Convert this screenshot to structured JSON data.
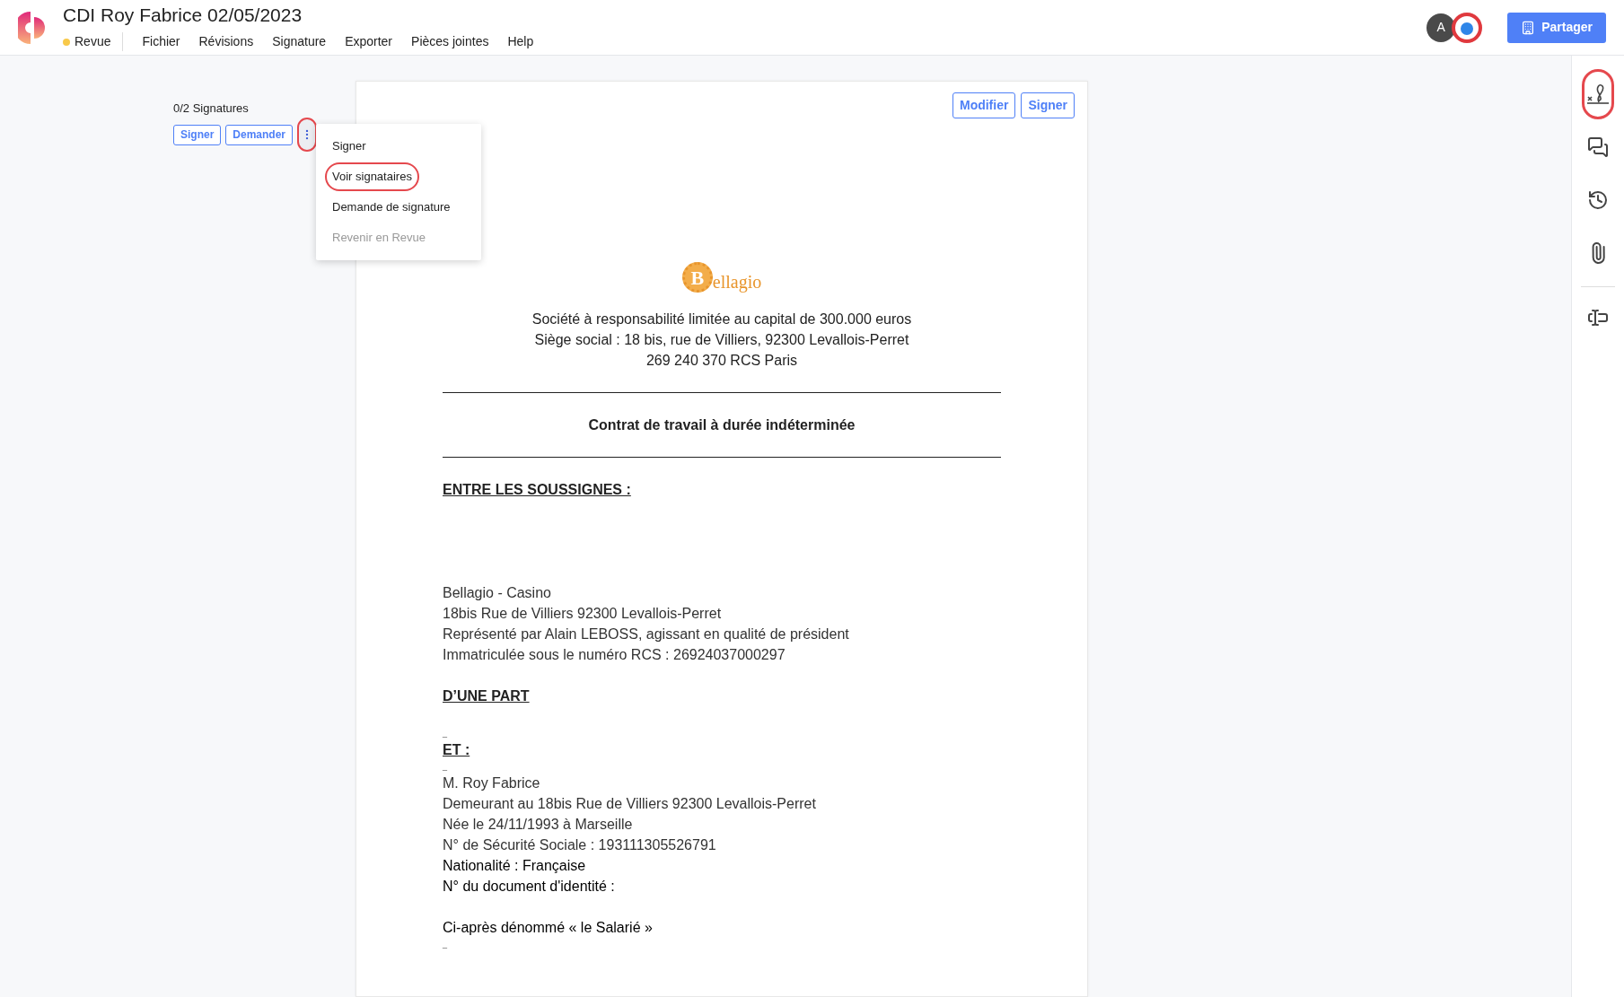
{
  "header": {
    "title": "CDI Roy Fabrice 02/05/2023",
    "status": {
      "label": "Revue",
      "color": "#f8c94a"
    },
    "menu": [
      "Fichier",
      "Révisions",
      "Signature",
      "Exporter",
      "Pièces jointes",
      "Help"
    ],
    "avatars": [
      {
        "kind": "letter",
        "text": "A"
      },
      {
        "kind": "logo"
      }
    ],
    "share_button": "Partager"
  },
  "signature_panel": {
    "count": "0/2 Signatures",
    "buttons": [
      "Signer",
      "Demander"
    ],
    "more_button": {
      "highlighted": true
    },
    "dropdown": [
      {
        "label": "Signer",
        "disabled": false,
        "highlighted": false
      },
      {
        "label": "Voir signataires",
        "disabled": false,
        "highlighted": true
      },
      {
        "label": "Demande de signature",
        "disabled": false,
        "highlighted": false
      },
      {
        "label": "Revenir en Revue",
        "disabled": true,
        "highlighted": false
      }
    ]
  },
  "document": {
    "buttons": [
      "Modifier",
      "Signer"
    ],
    "logo": {
      "initial": "B",
      "rest": "ellagio"
    },
    "blocks": [
      {
        "kind": "center",
        "text": "Société à responsabilité limitée au capital de 300.000 euros"
      },
      {
        "kind": "center",
        "text": "Siège social : 18 bis, rue de Villiers, 92300 Levallois-Perret"
      },
      {
        "kind": "center",
        "text": "269 240 370 RCS Paris"
      },
      {
        "kind": "rule"
      },
      {
        "kind": "title",
        "text": "Contrat de travail à durée indéterminée"
      },
      {
        "kind": "rule"
      },
      {
        "kind": "heading",
        "text": "ENTRE LES SOUSSIGNES :"
      },
      {
        "kind": "blank"
      },
      {
        "kind": "blank"
      },
      {
        "kind": "blank"
      },
      {
        "kind": "blank"
      },
      {
        "kind": "line",
        "text": "Bellagio - Casino"
      },
      {
        "kind": "line",
        "text": "18bis Rue de Villiers 92300 Levallois-Perret"
      },
      {
        "kind": "line",
        "text": "Représenté par Alain LEBOSS, agissant en qualité de président"
      },
      {
        "kind": "line",
        "text": "Immatriculée sous le numéro RCS : 26924037000297"
      },
      {
        "kind": "blank"
      },
      {
        "kind": "heading",
        "text": "D’UNE PART"
      },
      {
        "kind": "blank"
      },
      {
        "kind": "mark",
        "text": "_"
      },
      {
        "kind": "heading",
        "text": "ET :"
      },
      {
        "kind": "mark",
        "text": "_"
      },
      {
        "kind": "line",
        "text": "M. Roy Fabrice"
      },
      {
        "kind": "line",
        "text": "Demeurant au 18bis Rue de Villiers 92300 Levallois-Perret"
      },
      {
        "kind": "line",
        "text": "Née le 24/11/1993 à Marseille"
      },
      {
        "kind": "line",
        "text": "N° de Sécurité Sociale : 193111305526791"
      },
      {
        "kind": "dark",
        "text": "Nationalité : Française"
      },
      {
        "kind": "dark",
        "text": "N° du document d'identité :"
      },
      {
        "kind": "blank"
      },
      {
        "kind": "dark",
        "text": "Ci-après dénommé « le Salarié »"
      },
      {
        "kind": "mark",
        "text": "_"
      }
    ]
  },
  "rail": [
    {
      "kind": "signature",
      "highlighted": true
    },
    {
      "kind": "comments",
      "highlighted": false
    },
    {
      "kind": "history",
      "highlighted": false
    },
    {
      "kind": "attachment",
      "highlighted": false
    },
    {
      "kind": "divider"
    },
    {
      "kind": "text-field",
      "highlighted": false
    }
  ]
}
